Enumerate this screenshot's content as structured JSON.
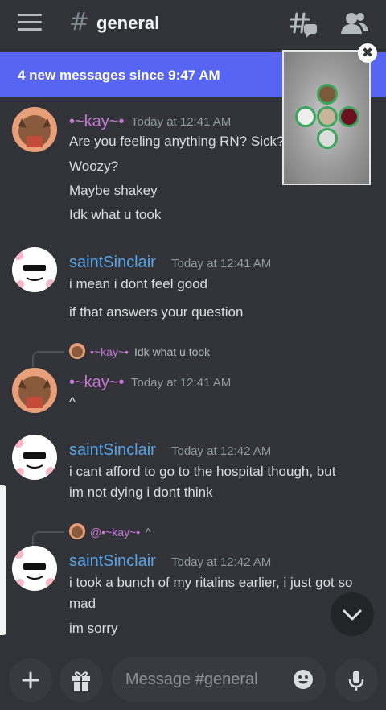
{
  "header": {
    "channel_hash": "#",
    "channel_name": "general",
    "menu_icon": "hamburger-menu-icon",
    "threads_icon": "threads-icon",
    "members_icon": "members-icon"
  },
  "new_messages_bar": {
    "text": "4 new messages since 9:47 AM"
  },
  "pip": {
    "close_icon": "close-icon",
    "close_glyph": "✖"
  },
  "messages": [
    {
      "username": "•~kay~•",
      "timestamp": "Today at 12:41 AM",
      "lines": [
        "Are you feeling anything RN? Sick?",
        "Woozy?",
        "Maybe shakey",
        "Idk what u took"
      ]
    },
    {
      "username": "saintSinclair",
      "timestamp": "Today at 12:41 AM",
      "lines": [
        "i mean i dont feel good",
        "if that answers your question"
      ]
    },
    {
      "reply": {
        "name": "•~kay~•",
        "text": "Idk what u took"
      },
      "username": "•~kay~•",
      "timestamp": "Today at 12:41 AM",
      "lines": [
        "^"
      ]
    },
    {
      "username": "saintSinclair",
      "timestamp": "Today at 12:42 AM",
      "lines": [
        "i cant afford to go to the hospital though, but",
        "im not dying i dont think"
      ]
    },
    {
      "reply": {
        "name": "@•~kay~•",
        "text": "^"
      },
      "username": "saintSinclair",
      "timestamp": "Today at 12:42 AM",
      "lines": [
        "i took a bunch of my ritalins earlier, i just got so",
        "mad",
        "im sorry"
      ]
    }
  ],
  "composer": {
    "placeholder": "Message #general",
    "plus_icon": "plus-icon",
    "gift_icon": "gift-icon",
    "emoji_icon": "emoji-icon",
    "mic_icon": "microphone-icon"
  },
  "colors": {
    "background": "#313338",
    "accent": "#5865f2",
    "kay_name": "#c879d6",
    "saint_name": "#5aa3e4",
    "online": "#3ba55d"
  }
}
